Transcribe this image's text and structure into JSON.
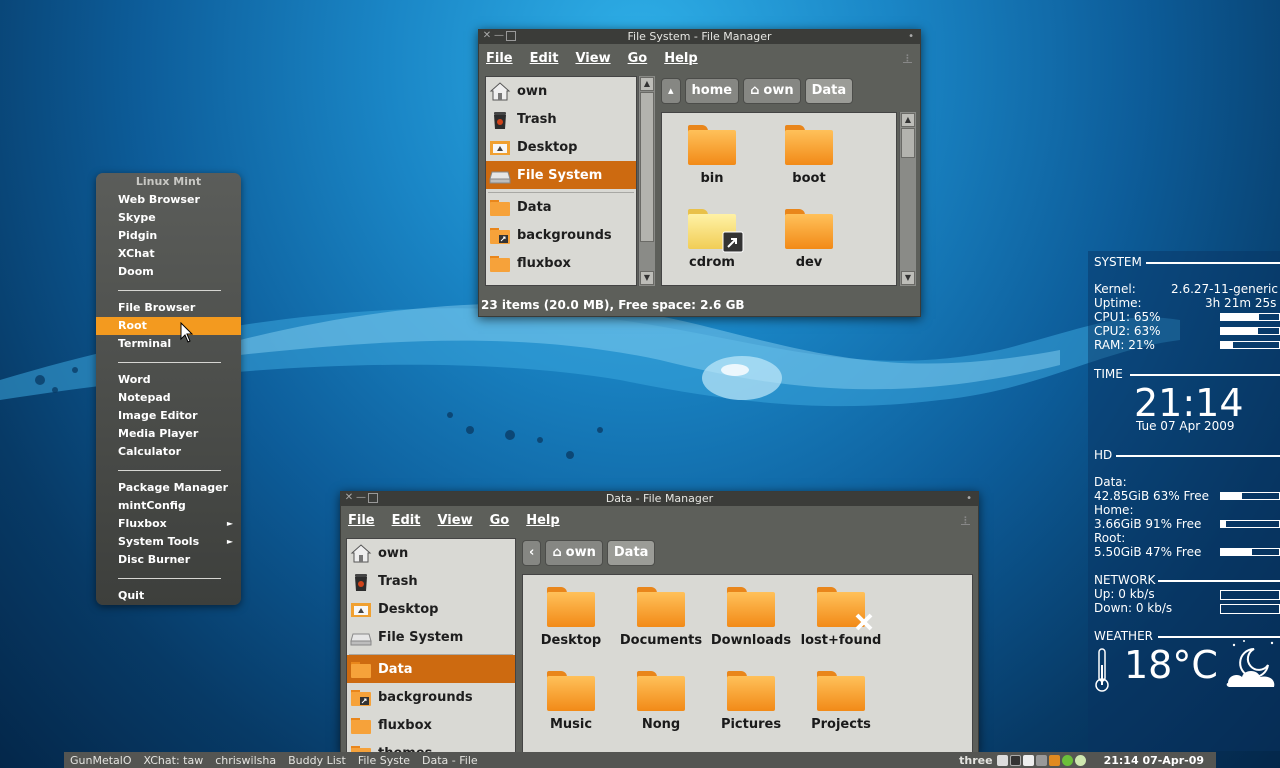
{
  "menu": {
    "title": "Linux Mint",
    "groups": [
      [
        "Web Browser",
        "Skype",
        "Pidgin",
        "XChat",
        "Doom"
      ],
      [
        "File Browser",
        "Root",
        "Terminal"
      ],
      [
        "Word",
        "Notepad",
        "Image Editor",
        "Media Player",
        "Calculator"
      ],
      [
        "Package Manager",
        "mintConfig",
        "Fluxbox",
        "System Tools",
        "Disc Burner"
      ],
      [
        "Quit"
      ]
    ],
    "active_item": "Root",
    "submenu_items": [
      "Fluxbox",
      "System Tools"
    ],
    "accent_color": "#f39a1f"
  },
  "win1": {
    "title": "File System - File Manager",
    "menus": [
      "File",
      "Edit",
      "View",
      "Go",
      "Help"
    ],
    "sidebar": [
      {
        "label": "own",
        "icon": "home-icon"
      },
      {
        "label": "Trash",
        "icon": "trash-icon"
      },
      {
        "label": "Desktop",
        "icon": "desktop-icon"
      },
      {
        "label": "File System",
        "icon": "drive-icon",
        "selected": true
      },
      {
        "label": "Data",
        "icon": "folder-icon"
      },
      {
        "label": "backgrounds",
        "icon": "folder-link-icon"
      },
      {
        "label": "fluxbox",
        "icon": "folder-icon"
      }
    ],
    "path": [
      "home",
      "own",
      "Data"
    ],
    "files": [
      "bin",
      "boot",
      "cdrom",
      "dev"
    ],
    "status": "23 items (20.0 MB), Free space: 2.6 GB",
    "selection_color": "#cd6a10"
  },
  "win2": {
    "title": "Data - File Manager",
    "menus": [
      "File",
      "Edit",
      "View",
      "Go",
      "Help"
    ],
    "sidebar": [
      {
        "label": "own",
        "icon": "home-icon"
      },
      {
        "label": "Trash",
        "icon": "trash-icon"
      },
      {
        "label": "Desktop",
        "icon": "desktop-icon"
      },
      {
        "label": "File System",
        "icon": "drive-icon"
      },
      {
        "label": "Data",
        "icon": "folder-icon",
        "selected": true
      },
      {
        "label": "backgrounds",
        "icon": "folder-link-icon"
      },
      {
        "label": "fluxbox",
        "icon": "folder-icon"
      },
      {
        "label": "themes",
        "icon": "folder-icon"
      }
    ],
    "path": [
      "own",
      "Data"
    ],
    "files": [
      "Desktop",
      "Documents",
      "Downloads",
      "lost+found",
      "Music",
      "Nong",
      "Pictures",
      "Projects"
    ]
  },
  "conky": {
    "system_header": "SYSTEM",
    "kernel_label": "Kernel:",
    "kernel_value": "2.6.27-11-generic",
    "uptime_label": "Uptime:",
    "uptime_value": "3h 21m 25s",
    "cpu1": "CPU1: 65%",
    "cpu2": "CPU2: 63%",
    "ram": "RAM: 21%",
    "cpu1_level": 0.65,
    "cpu2_level": 0.63,
    "ram_level": 0.21,
    "time_header": "TIME",
    "clock": "21:14",
    "date": "Tue 07 Apr 2009",
    "hd_header": "HD",
    "data_label": "Data:",
    "data_value": "42.85GiB 63% Free",
    "data_used": 0.37,
    "home_label": "Home:",
    "home_value": "3.66GiB 91% Free",
    "home_used": 0.09,
    "root_label": "Root:",
    "root_value": "5.50GiB 47% Free",
    "root_used": 0.53,
    "network_header": "NETWORK",
    "up": "Up: 0 kb/s",
    "down": "Down: 0 kb/s",
    "weather_header": "WEATHER",
    "temperature": "18°C"
  },
  "taskbar": {
    "tasks": [
      "GunMetalO",
      "XChat: taw",
      "chriswilsha",
      "Buddy List",
      "File Syste",
      "Data - File"
    ],
    "workspace": "three",
    "clock": "21:14 07-Apr-09"
  }
}
